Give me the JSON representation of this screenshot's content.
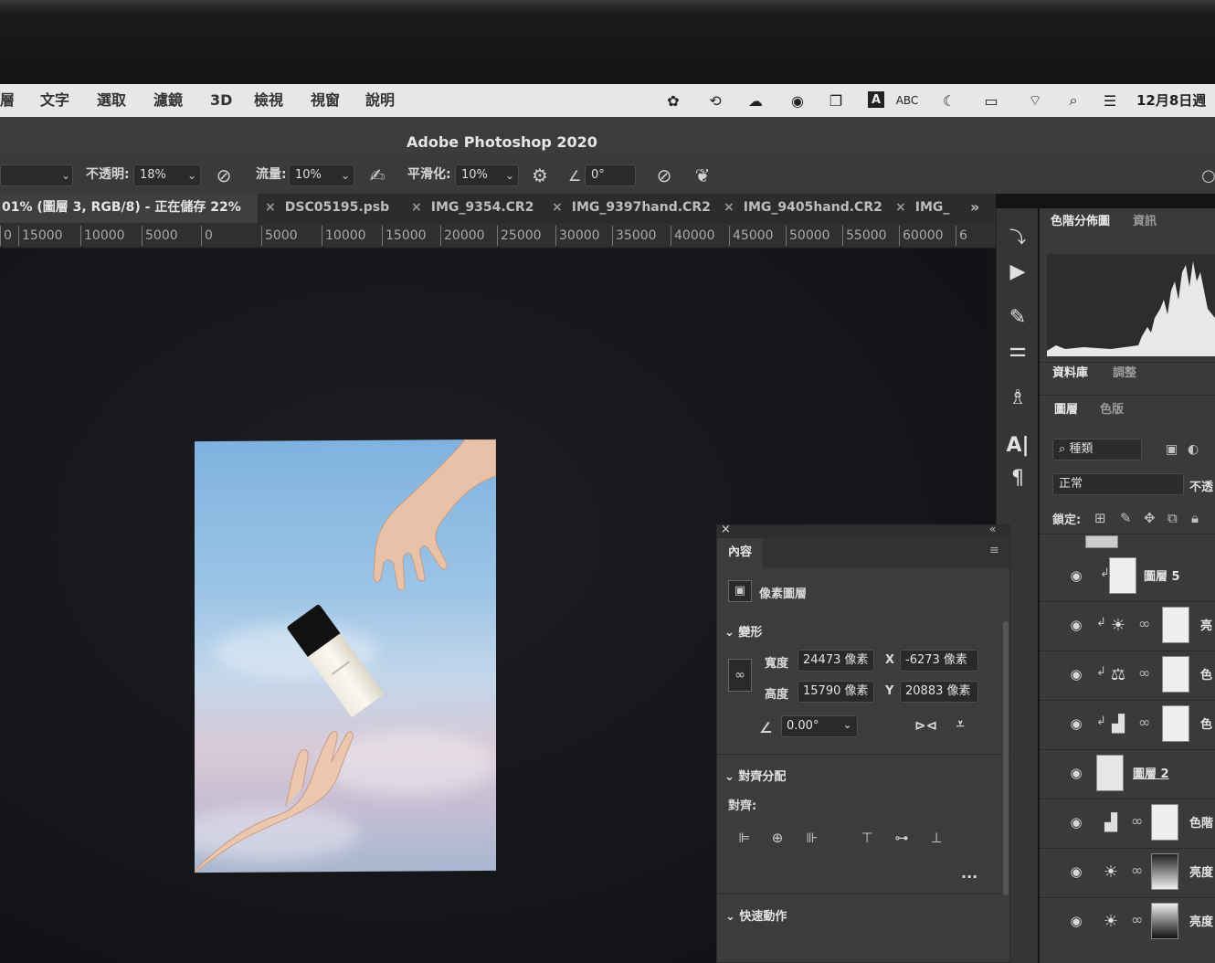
{
  "menubar": {
    "items": [
      "層",
      "文字",
      "選取",
      "濾鏡",
      "3D",
      "檢視",
      "視窗",
      "說明"
    ],
    "input_source": "ABC",
    "clock": "12月8日週"
  },
  "app": {
    "title": "Adobe Photoshop 2020"
  },
  "options": {
    "opacity_label": "不透明:",
    "opacity_value": "18%",
    "flow_label": "流量:",
    "flow_value": "10%",
    "smoothing_label": "平滑化:",
    "smoothing_value": "10%",
    "angle_value": "0°"
  },
  "tabs": {
    "active": "01% (圖層 3, RGB/8) - 正在儲存 22%",
    "others": [
      "DSC05195.psb",
      "IMG_9354.CR2",
      "IMG_9397hand.CR2",
      "IMG_9405hand.CR2",
      "IMG_"
    ],
    "overflow": "»"
  },
  "ruler": {
    "ticks": [
      "0",
      "15000",
      "10000",
      "5000",
      "0",
      "5000",
      "10000",
      "15000",
      "20000",
      "25000",
      "30000",
      "35000",
      "40000",
      "45000",
      "50000",
      "55000",
      "60000",
      "6"
    ]
  },
  "right_panel": {
    "tabs_top": [
      "色階分佈圖",
      "資訊"
    ],
    "tabs_mid": [
      "資料庫",
      "調整"
    ],
    "tabs_layers": [
      "圖層",
      "色版"
    ],
    "filter_kind": "種類",
    "blend_mode": "正常",
    "opacity_short": "不透",
    "lock_label": "鎖定:",
    "layers": [
      {
        "name": "圖層 5"
      },
      {
        "name": "亮"
      },
      {
        "name": "色"
      },
      {
        "name": "色"
      },
      {
        "name": "圖層 2"
      },
      {
        "name": "色階"
      },
      {
        "name": "亮度"
      },
      {
        "name": "亮度"
      }
    ]
  },
  "properties": {
    "tab": "內容",
    "layer_type": "像素圖層",
    "transform_title": "變形",
    "width_label": "寬度",
    "width_value": "24473 像素",
    "height_label": "高度",
    "height_value": "15790 像素",
    "x_label": "X",
    "x_value": "-6273 像素",
    "y_label": "Y",
    "y_value": "20883 像素",
    "angle_value": "0.00°",
    "align_title": "對齊分配",
    "align_label": "對齊:",
    "more": "...",
    "quick_actions_title": "快速動作"
  },
  "colors": {
    "menubar_bg": "#e9e6e6",
    "app_chrome": "#3a3a3a",
    "canvas_bg": "#15161a"
  }
}
